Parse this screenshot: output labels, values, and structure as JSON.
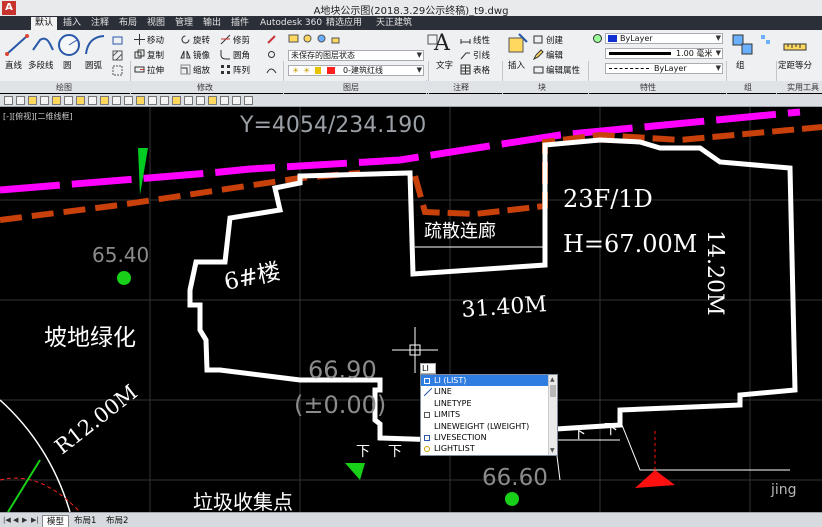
{
  "window": {
    "title": "A地块公示图(2018.3.29公示终稿)_t9.dwg",
    "app_icon": "A"
  },
  "tabs": [
    {
      "label": "默认",
      "active": true
    },
    {
      "label": "插入"
    },
    {
      "label": "注释"
    },
    {
      "label": "布局"
    },
    {
      "label": "视图"
    },
    {
      "label": "管理"
    },
    {
      "label": "输出"
    },
    {
      "label": "插件"
    },
    {
      "label": "Autodesk 360"
    },
    {
      "label": "精选应用"
    },
    {
      "label": "天正建筑"
    }
  ],
  "ribbon": {
    "draw_tools": [
      "直线",
      "多段线",
      "圆",
      "圆弧"
    ],
    "modify_tools": [
      "移动",
      "旋转",
      "修剪",
      "复制",
      "镜像",
      "圆角",
      "拉伸",
      "缩放",
      "阵列"
    ],
    "layer_state": "未保存的图层状态",
    "current_layer": "0-建筑红线",
    "annotation_tools": [
      "文字",
      "线性",
      "引线",
      "表格"
    ],
    "block_tools": [
      "插入",
      "创建",
      "编辑",
      "编辑属性"
    ],
    "property_color": "ByLayer",
    "property_lineweight": "1.00 毫米",
    "property_linetype": "ByLayer",
    "group_label": "组",
    "utility_label": "定距等分",
    "panel_titles": [
      "绘图",
      "修改",
      "图层",
      "注释",
      "块",
      "特性",
      "组",
      "实用工具"
    ]
  },
  "viewport_label": "[-][俯视][二维线框]",
  "drawing": {
    "coord_text": "Y=4054/234.190",
    "elev_1": "65.40",
    "green_area": "坡地绿化",
    "building_name": "6#楼",
    "corridor": "疏散连廊",
    "floors": "23F/1D",
    "height": "H=67.00M",
    "width_dim": "31.40M",
    "depth_dim": "14.20M",
    "elev_2": "66.90",
    "elev_2b": "(±0.00)",
    "radius": "R12.00M",
    "entry_mark": "下",
    "elev_3": "66.60",
    "garbage": "垃圾收集点"
  },
  "command": {
    "input": "LI",
    "suggestions": [
      "LI (LIST)",
      "LINE",
      "LINETYPE",
      "LIMITS",
      "LINEWEIGHT (LWEIGHT)",
      "LIVESECTION",
      "LIGHTLIST"
    ],
    "selected_index": 0
  },
  "layout_tabs": [
    {
      "label": "模型",
      "active": true
    },
    {
      "label": "布局1"
    },
    {
      "label": "布局2"
    }
  ],
  "watermark": "jing",
  "colors": {
    "accent": "#2f7de1",
    "magenta": "#ff00ff",
    "orange": "#c8400a",
    "green": "#00e000",
    "red": "#ff1a1a",
    "grid_gray": "#3a3a3a"
  }
}
